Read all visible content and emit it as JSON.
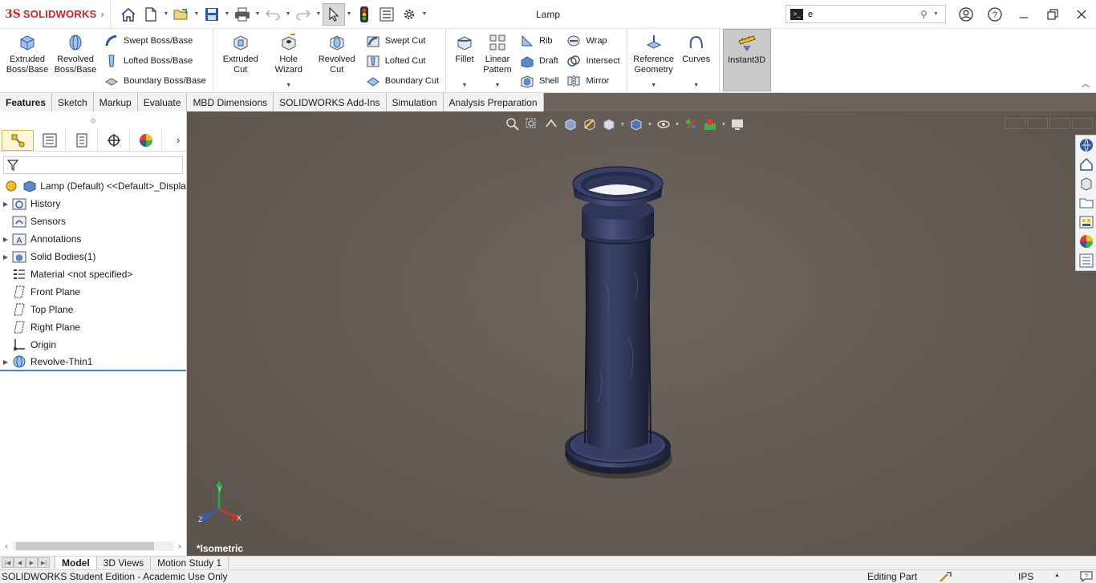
{
  "app": {
    "logo_ds": "3S",
    "logo_text": "SOLIDWORKS",
    "window_title": "Lamp",
    "search_value": "e"
  },
  "ribbon": {
    "extruded_boss": "Extruded\nBoss/Base",
    "revolved_boss": "Revolved\nBoss/Base",
    "swept_boss": "Swept Boss/Base",
    "lofted_boss": "Lofted Boss/Base",
    "boundary_boss": "Boundary Boss/Base",
    "extruded_cut": "Extruded\nCut",
    "hole_wizard": "Hole\nWizard",
    "revolved_cut": "Revolved\nCut",
    "swept_cut": "Swept Cut",
    "lofted_cut": "Lofted Cut",
    "boundary_cut": "Boundary Cut",
    "fillet": "Fillet",
    "linear_pattern": "Linear\nPattern",
    "rib": "Rib",
    "draft": "Draft",
    "shell": "Shell",
    "wrap": "Wrap",
    "intersect": "Intersect",
    "mirror": "Mirror",
    "reference_geometry": "Reference\nGeometry",
    "curves": "Curves",
    "instant3d": "Instant3D"
  },
  "command_tabs": [
    "Features",
    "Sketch",
    "Markup",
    "Evaluate",
    "MBD Dimensions",
    "SOLIDWORKS Add-Ins",
    "Simulation",
    "Analysis Preparation"
  ],
  "tree": {
    "root": "Lamp (Default) <<Default>_Displa",
    "items": [
      {
        "label": "History",
        "expandable": true
      },
      {
        "label": "Sensors",
        "expandable": false
      },
      {
        "label": "Annotations",
        "expandable": true
      },
      {
        "label": "Solid Bodies(1)",
        "expandable": true
      },
      {
        "label": "Material <not specified>",
        "expandable": false
      },
      {
        "label": "Front Plane",
        "expandable": false
      },
      {
        "label": "Top Plane",
        "expandable": false
      },
      {
        "label": "Right Plane",
        "expandable": false
      },
      {
        "label": "Origin",
        "expandable": false
      },
      {
        "label": "Revolve-Thin1",
        "expandable": true
      }
    ]
  },
  "viewport": {
    "view_name": "*Isometric",
    "triad_x": "X",
    "triad_y": "Y",
    "triad_z": "Z"
  },
  "bottom_tabs": [
    "Model",
    "3D Views",
    "Motion Study 1"
  ],
  "status": {
    "edition": "SOLIDWORKS Student Edition - Academic Use Only",
    "mode": "Editing Part",
    "units": "IPS"
  },
  "colors": {
    "brand_red": "#d31f26",
    "viewport_bg": "#615952",
    "model_blue": "#2e3552",
    "tree_accent": "#3c8fc8"
  }
}
